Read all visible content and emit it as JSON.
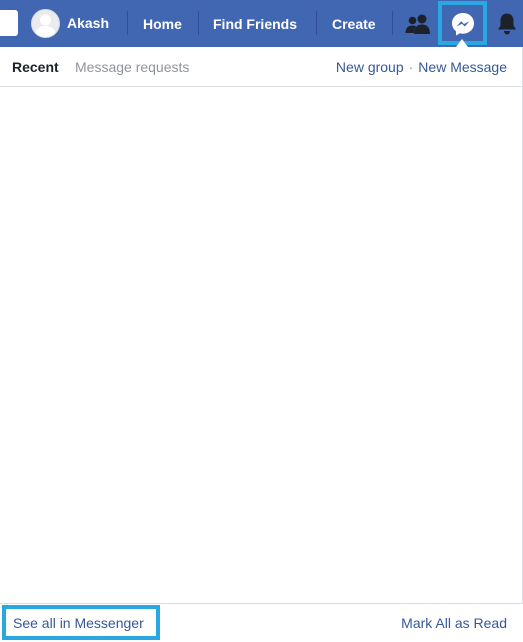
{
  "topbar": {
    "profile_name": "Akash",
    "nav": {
      "home": "Home",
      "find_friends": "Find Friends",
      "create": "Create"
    },
    "icons": {
      "friend_requests": "friends-icon",
      "messenger": "messenger-icon",
      "notifications": "bell-icon"
    }
  },
  "messages_panel": {
    "tabs": [
      {
        "label": "Recent",
        "active": true
      },
      {
        "label": "Message requests",
        "active": false
      }
    ],
    "actions": {
      "new_group": "New group",
      "separator": "·",
      "new_message": "New Message"
    },
    "footer": {
      "see_all": "See all in Messenger",
      "mark_all_read": "Mark All as Read"
    }
  },
  "colors": {
    "topbar_bg": "#4267b2",
    "link": "#365899",
    "highlight": "#29a7e1",
    "muted_text": "#90949c"
  }
}
